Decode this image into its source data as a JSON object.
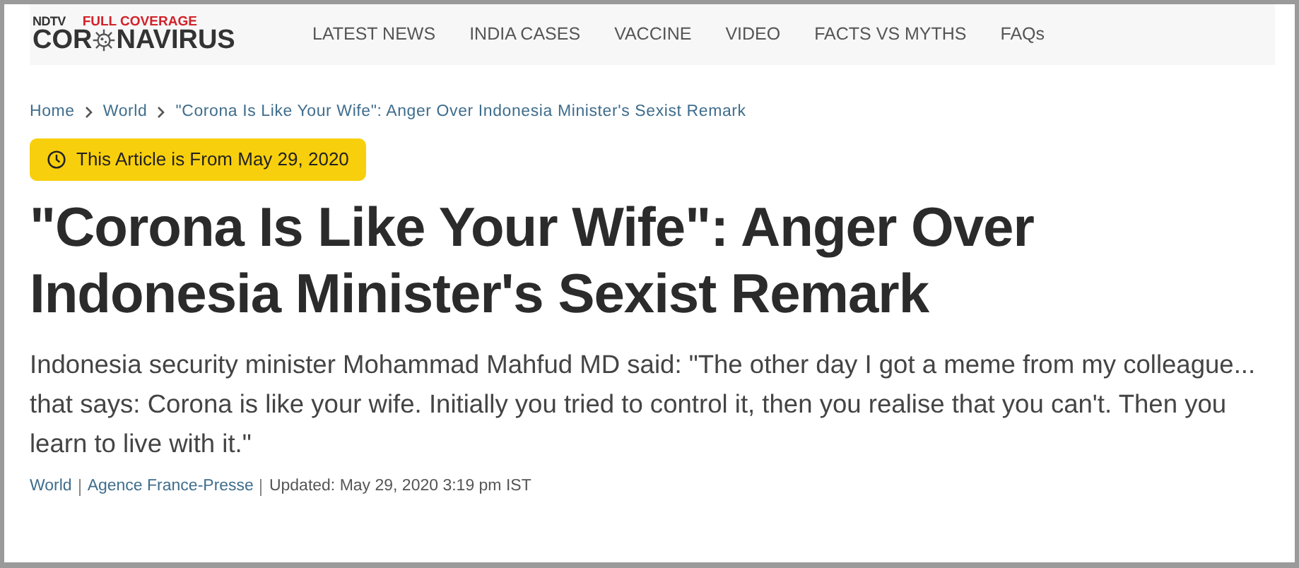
{
  "logo": {
    "brand": "NDTV",
    "tag": "FULL COVERAGE",
    "word_start": "COR",
    "word_end": "NAVIRUS"
  },
  "nav": [
    "LATEST NEWS",
    "INDIA CASES",
    "VACCINE",
    "VIDEO",
    "FACTS VS MYTHS",
    "FAQs"
  ],
  "breadcrumb": [
    "Home",
    "World",
    "\"Corona Is Like Your Wife\": Anger Over Indonesia Minister's Sexist Remark"
  ],
  "notice": "This Article is From May 29, 2020",
  "headline": "\"Corona Is Like Your Wife\": Anger Over Indonesia Minister's Sexist Remark",
  "summary": "Indonesia security minister Mohammad Mahfud MD said: \"The other day I got a meme from my colleague... that says: Corona is like your wife. Initially you tried to control it, then you realise that you can't. Then you learn to live with it.\"",
  "byline": {
    "category": "World",
    "source": "Agence France-Presse",
    "updated": "Updated: May 29, 2020 3:19 pm IST"
  }
}
